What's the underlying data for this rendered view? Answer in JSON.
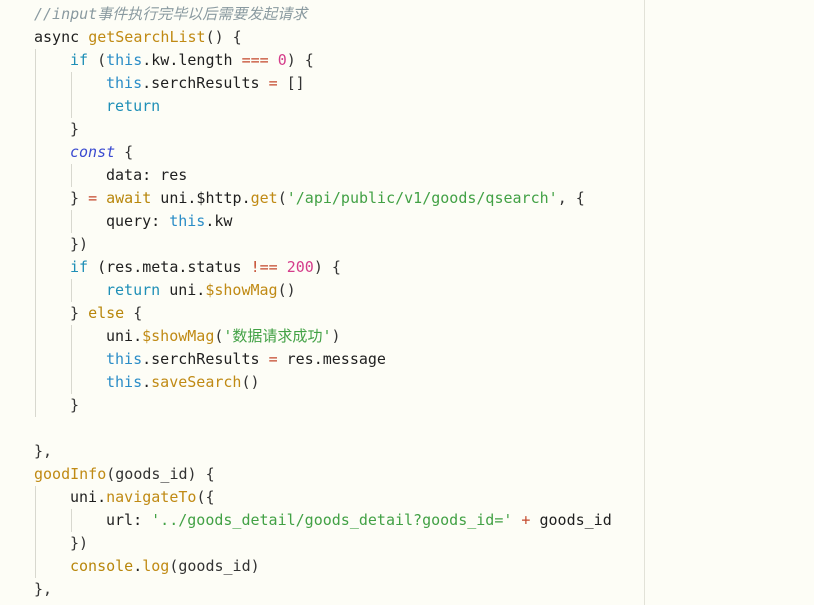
{
  "editor": {
    "lines": [
      {
        "indent": 0,
        "tokens": [
          {
            "t": "//input事件执行完毕以后需要发起请求",
            "c": "comment"
          }
        ]
      },
      {
        "indent": 0,
        "tokens": [
          {
            "t": "async ",
            "c": "plain"
          },
          {
            "t": "getSearchList",
            "c": "fn"
          },
          {
            "t": "() {",
            "c": "punc"
          }
        ]
      },
      {
        "indent": 1,
        "tokens": [
          {
            "t": "if",
            "c": "kw-ctl"
          },
          {
            "t": " (",
            "c": "punc"
          },
          {
            "t": "this",
            "c": "this"
          },
          {
            "t": ".kw.length ",
            "c": "plain"
          },
          {
            "t": "===",
            "c": "op"
          },
          {
            "t": " ",
            "c": "plain"
          },
          {
            "t": "0",
            "c": "num"
          },
          {
            "t": ") {",
            "c": "punc"
          }
        ]
      },
      {
        "indent": 2,
        "tokens": [
          {
            "t": "this",
            "c": "this"
          },
          {
            "t": ".serchResults ",
            "c": "plain"
          },
          {
            "t": "=",
            "c": "op"
          },
          {
            "t": " []",
            "c": "punc"
          }
        ]
      },
      {
        "indent": 2,
        "tokens": [
          {
            "t": "return",
            "c": "kw-ctl"
          }
        ]
      },
      {
        "indent": 1,
        "tokens": [
          {
            "t": "}",
            "c": "punc"
          }
        ]
      },
      {
        "indent": 1,
        "tokens": [
          {
            "t": "const",
            "c": "storage"
          },
          {
            "t": " {",
            "c": "punc"
          }
        ]
      },
      {
        "indent": 2,
        "tokens": [
          {
            "t": "data: res",
            "c": "plain"
          }
        ]
      },
      {
        "indent": 1,
        "tokens": [
          {
            "t": "} ",
            "c": "punc"
          },
          {
            "t": "=",
            "c": "op"
          },
          {
            "t": " ",
            "c": "plain"
          },
          {
            "t": "await",
            "c": "kw"
          },
          {
            "t": " uni.$http.",
            "c": "plain"
          },
          {
            "t": "get",
            "c": "fn"
          },
          {
            "t": "(",
            "c": "punc"
          },
          {
            "t": "'/api/public/v1/goods/qsearch'",
            "c": "str"
          },
          {
            "t": ", {",
            "c": "punc"
          }
        ]
      },
      {
        "indent": 2,
        "tokens": [
          {
            "t": "query: ",
            "c": "plain"
          },
          {
            "t": "this",
            "c": "this"
          },
          {
            "t": ".kw",
            "c": "plain"
          }
        ]
      },
      {
        "indent": 1,
        "tokens": [
          {
            "t": "})",
            "c": "punc"
          }
        ]
      },
      {
        "indent": 1,
        "tokens": [
          {
            "t": "if",
            "c": "kw-ctl"
          },
          {
            "t": " (res.meta.status ",
            "c": "plain"
          },
          {
            "t": "!==",
            "c": "op"
          },
          {
            "t": " ",
            "c": "plain"
          },
          {
            "t": "200",
            "c": "num"
          },
          {
            "t": ") {",
            "c": "punc"
          }
        ]
      },
      {
        "indent": 2,
        "tokens": [
          {
            "t": "return",
            "c": "kw-ctl"
          },
          {
            "t": " uni.",
            "c": "plain"
          },
          {
            "t": "$showMag",
            "c": "fn"
          },
          {
            "t": "()",
            "c": "punc"
          }
        ]
      },
      {
        "indent": 1,
        "tokens": [
          {
            "t": "} ",
            "c": "punc"
          },
          {
            "t": "else",
            "c": "kw"
          },
          {
            "t": " {",
            "c": "punc"
          }
        ]
      },
      {
        "indent": 2,
        "tokens": [
          {
            "t": "uni.",
            "c": "plain"
          },
          {
            "t": "$showMag",
            "c": "fn"
          },
          {
            "t": "(",
            "c": "punc"
          },
          {
            "t": "'数据请求成功'",
            "c": "str"
          },
          {
            "t": ")",
            "c": "punc"
          }
        ]
      },
      {
        "indent": 2,
        "tokens": [
          {
            "t": "this",
            "c": "this"
          },
          {
            "t": ".serchResults ",
            "c": "plain"
          },
          {
            "t": "=",
            "c": "op"
          },
          {
            "t": " res.message",
            "c": "plain"
          }
        ]
      },
      {
        "indent": 2,
        "tokens": [
          {
            "t": "this",
            "c": "this"
          },
          {
            "t": ".",
            "c": "plain"
          },
          {
            "t": "saveSearch",
            "c": "fn"
          },
          {
            "t": "()",
            "c": "punc"
          }
        ]
      },
      {
        "indent": 1,
        "tokens": [
          {
            "t": "}",
            "c": "punc"
          }
        ]
      },
      {
        "indent": 0,
        "tokens": []
      },
      {
        "indent": 0,
        "tokens": [
          {
            "t": "},",
            "c": "punc"
          }
        ]
      },
      {
        "indent": 0,
        "tokens": [
          {
            "t": "goodInfo",
            "c": "fn"
          },
          {
            "t": "(goods_id) {",
            "c": "punc"
          }
        ]
      },
      {
        "indent": 1,
        "tokens": [
          {
            "t": "uni.",
            "c": "plain"
          },
          {
            "t": "navigateTo",
            "c": "fn"
          },
          {
            "t": "({",
            "c": "punc"
          }
        ]
      },
      {
        "indent": 2,
        "tokens": [
          {
            "t": "url: ",
            "c": "plain"
          },
          {
            "t": "'../goods_detail/goods_detail?goods_id='",
            "c": "str"
          },
          {
            "t": " ",
            "c": "plain"
          },
          {
            "t": "+",
            "c": "op"
          },
          {
            "t": " goods_id",
            "c": "plain"
          }
        ]
      },
      {
        "indent": 1,
        "tokens": [
          {
            "t": "})",
            "c": "punc"
          }
        ]
      },
      {
        "indent": 1,
        "tokens": [
          {
            "t": "console",
            "c": "kw"
          },
          {
            "t": ".",
            "c": "plain"
          },
          {
            "t": "log",
            "c": "fn"
          },
          {
            "t": "(goods_id)",
            "c": "punc"
          }
        ]
      },
      {
        "indent": 0,
        "tokens": [
          {
            "t": "},",
            "c": "punc"
          }
        ]
      }
    ]
  }
}
